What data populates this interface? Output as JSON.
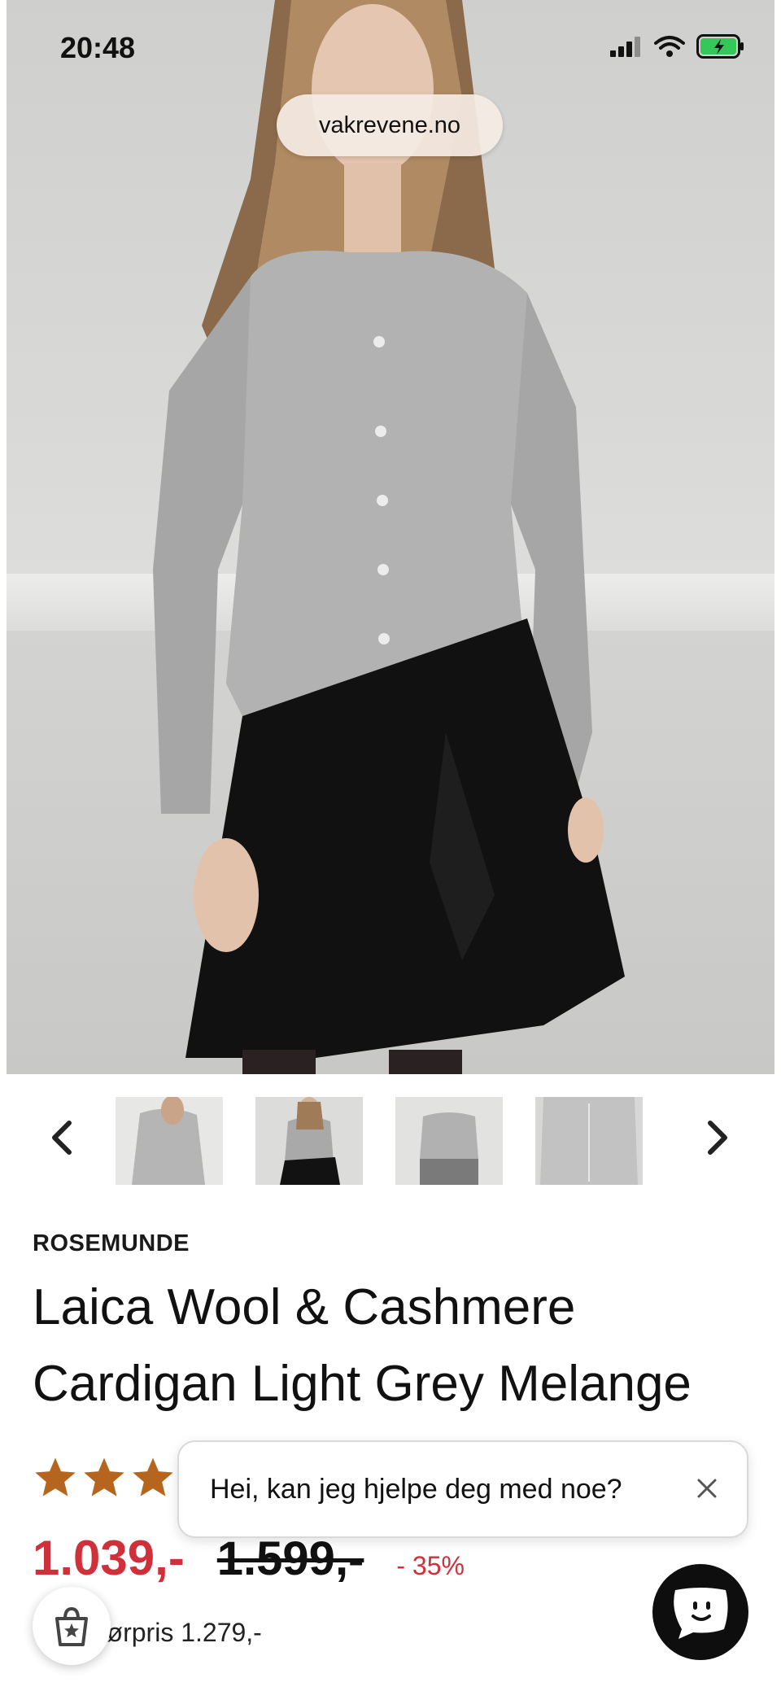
{
  "status_bar": {
    "time": "20:48"
  },
  "browser": {
    "url": "vakrevene.no"
  },
  "gallery": {
    "prev_icon": "chevron-left-icon",
    "next_icon": "chevron-right-icon",
    "thumbnails": [
      "thumb-1",
      "thumb-2",
      "thumb-3",
      "thumb-4"
    ]
  },
  "product": {
    "brand": "ROSEMUNDE",
    "title": "Laica Wool & Cashmere Cardigan Light Grey Melange",
    "rating_stars_visible": 3,
    "star_color": "#b5651d",
    "price_now": "1.039,-",
    "price_old": "1.599,-",
    "discount": "- 35%",
    "ref_price": "Førpris 1.279,-",
    "accent_color": "#d0303a"
  },
  "chat": {
    "message": "Hei, kan jeg hjelpe deg med noe?",
    "close_icon": "close-icon",
    "launcher_icon": "chat-bot-icon"
  },
  "shop_button": {
    "icon": "shopping-bag-star-icon"
  }
}
